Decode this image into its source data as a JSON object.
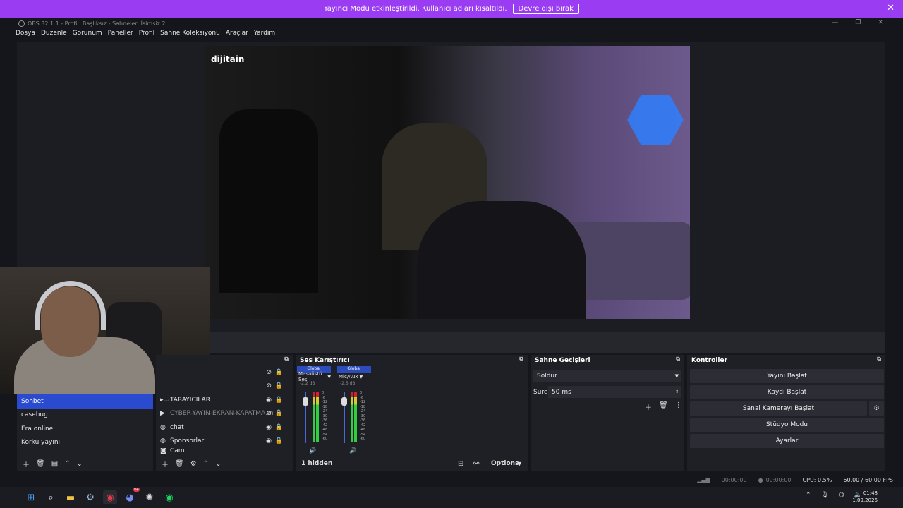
{
  "banner": {
    "message": "Yayıncı Modu etkinleştirildi. Kullanıcı adları kısaltıldı.",
    "button_label": "Devre dışı bırak",
    "close_icon": "close-icon"
  },
  "window": {
    "title": "OBS 32.1.1 - Profil: Başlıksız - Sahneler: İsimsiz 2"
  },
  "menu": [
    "Dosya",
    "Düzenle",
    "Görünüm",
    "Paneller",
    "Profil",
    "Sahne Koleksiyonu",
    "Araçlar",
    "Yardım"
  ],
  "preview": {
    "watermark": "dijitain"
  },
  "scenes": {
    "items": [
      {
        "label": "Sohbet",
        "selected": true
      },
      {
        "label": "casehug",
        "selected": false
      },
      {
        "label": "Era online",
        "selected": false
      },
      {
        "label": "Korku yayını",
        "selected": false
      }
    ]
  },
  "sources": {
    "items": [
      {
        "label": "TARAYICILAR",
        "icon": "folder-icon",
        "visible": true,
        "dim": false
      },
      {
        "label": "CYBER-YAYIN-EKRAN-KAPATMA.m",
        "icon": "play-icon",
        "visible": false,
        "dim": true
      },
      {
        "label": "chat",
        "icon": "globe-icon",
        "visible": true,
        "dim": false
      },
      {
        "label": "Sponsorlar",
        "icon": "globe-icon",
        "visible": true,
        "dim": false
      },
      {
        "label": "Cam",
        "icon": "camera-icon",
        "visible": true,
        "dim": false
      }
    ]
  },
  "mixer": {
    "title": "Ses Karıştırıcı",
    "channels": [
      {
        "global_label": "Global",
        "name": "Masaüstü Ses",
        "db": "-2.2 dB",
        "level": 0.77
      },
      {
        "global_label": "Global",
        "name": "Mic/Aux",
        "db": "-2.5 dB",
        "level": 0.75
      }
    ],
    "ticks": [
      "0",
      "-6",
      "-12",
      "-18",
      "-24",
      "-30",
      "-36",
      "-42",
      "-48",
      "-54",
      "-60"
    ],
    "hidden_label": "1 hidden",
    "options_label": "Options"
  },
  "transitions": {
    "title": "Sahne Geçişleri",
    "selected": "Soldur",
    "duration_label": "Süre",
    "duration_value": "50 ms"
  },
  "controls": {
    "title": "Kontroller",
    "buttons": [
      "Yayını Başlat",
      "Kaydı Başlat",
      "Sanal Kamerayı Başlat",
      "Stüdyo Modu",
      "Ayarlar"
    ]
  },
  "status": {
    "stream_time": "00:00:00",
    "rec_time": "00:00:00",
    "cpu": "CPU: 0.5%",
    "fps": "60.00 / 60.00 FPS"
  },
  "taskbar": {
    "time": "01:48",
    "date": "1.09.2026",
    "discord_badge": "9+"
  },
  "colors": {
    "accent": "#9a3cf2",
    "selection": "#2a4bd0",
    "global_tag": "#2c4bbd"
  }
}
